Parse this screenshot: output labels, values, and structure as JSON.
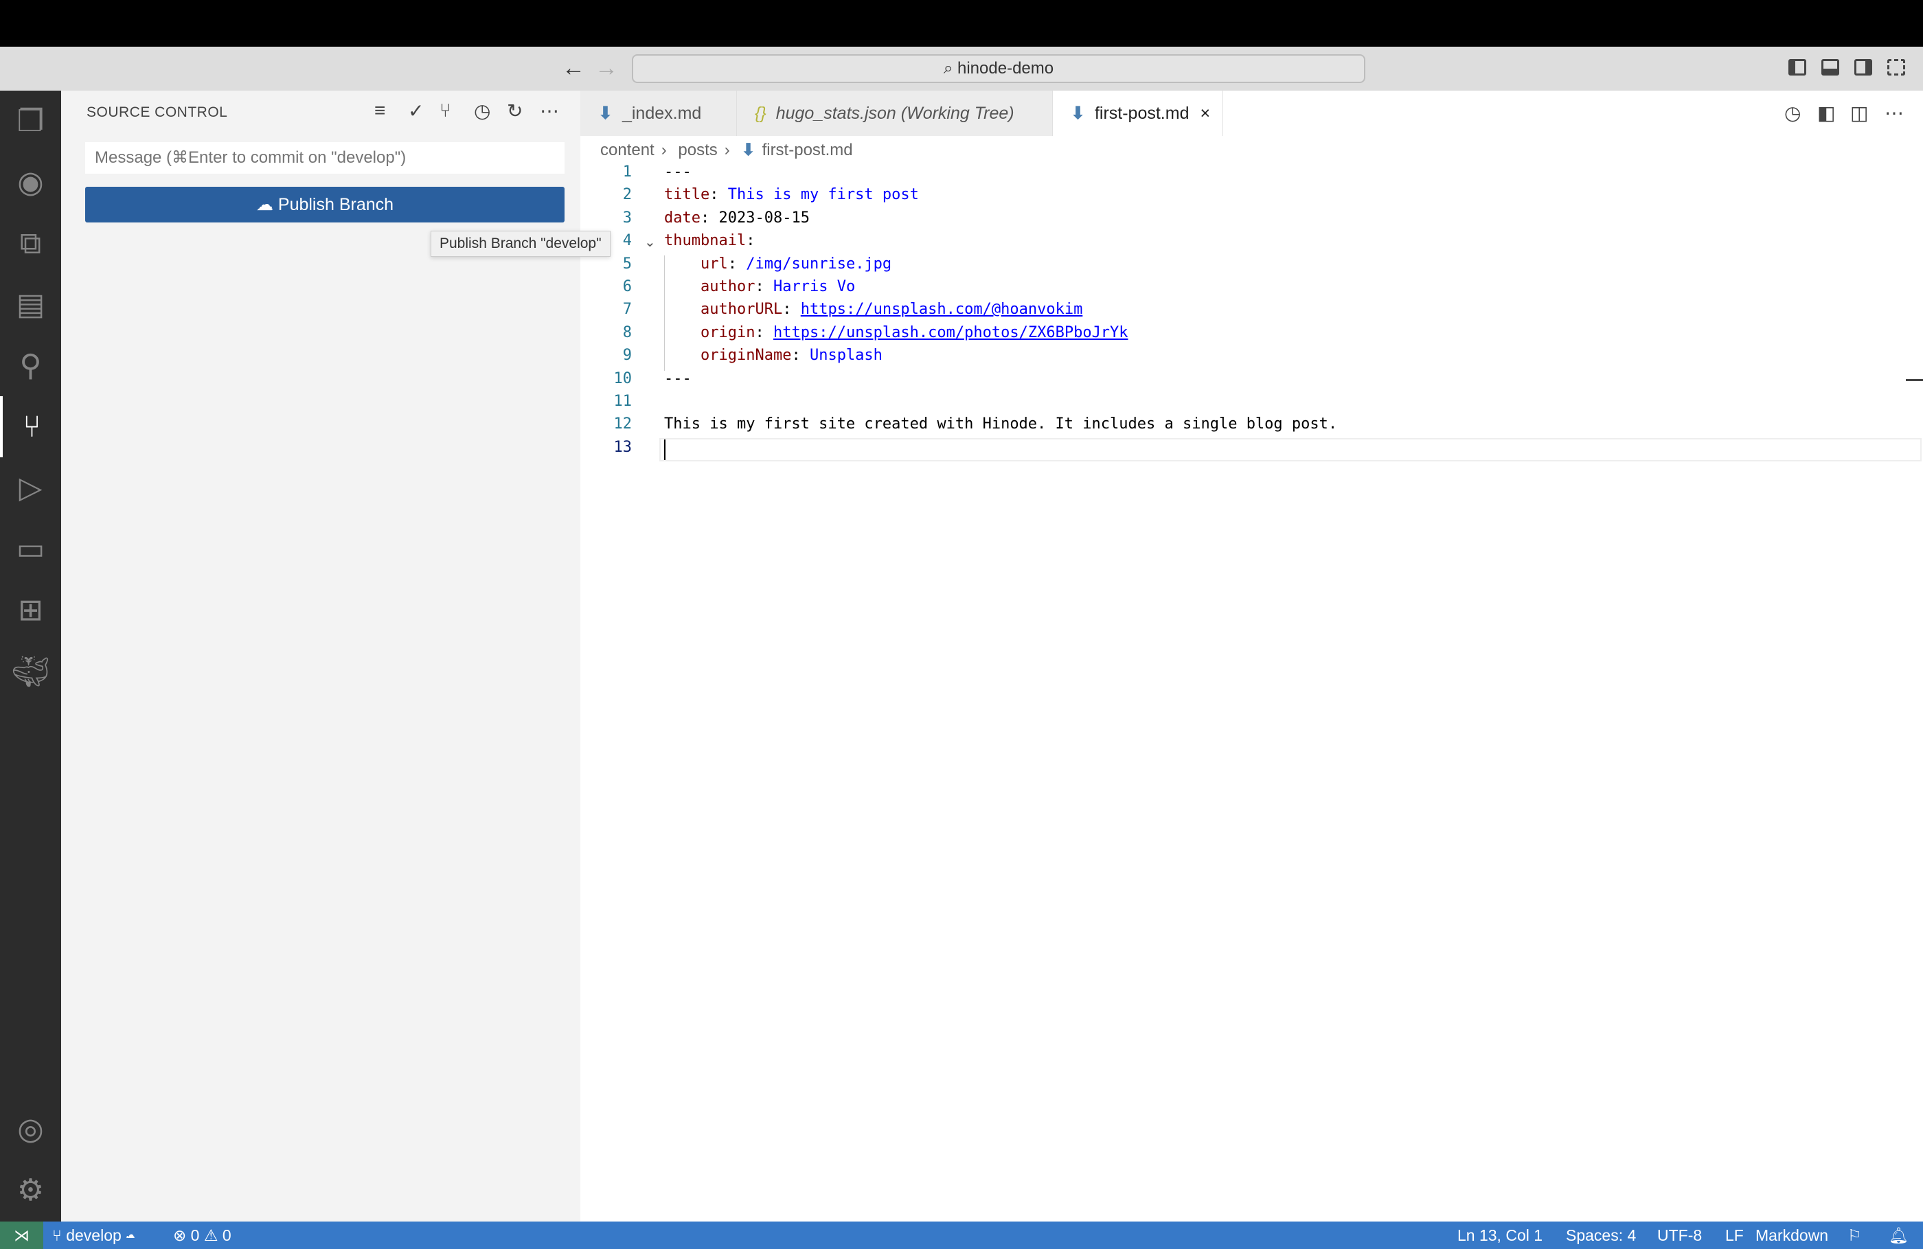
{
  "title_bar": {
    "search": "hinode-demo",
    "back_icon": "arrow-left",
    "forward_icon": "arrow-right"
  },
  "activity_bar": [
    "explorer-icon",
    "github-icon",
    "remote-explorer-icon",
    "book-icon",
    "search-icon",
    "source-control-icon",
    "run-debug-icon",
    "remote-icon",
    "extensions-icon",
    "docker-icon",
    "account-icon",
    "settings-gear-icon"
  ],
  "sidebar": {
    "title": "SOURCE CONTROL",
    "message_placeholder": "Message (⌘Enter to commit on \"develop\")",
    "publish_label": "Publish Branch",
    "tooltip": "Publish Branch \"develop\""
  },
  "tabs": [
    {
      "label": "_index.md"
    },
    {
      "label": "hugo_stats.json (Working Tree)"
    },
    {
      "label": "first-post.md",
      "close": "×"
    }
  ],
  "breadcrumb": [
    "content",
    "posts",
    "first-post.md"
  ],
  "editor": {
    "line_numbers": [
      "1",
      "2",
      "3",
      "4",
      "5",
      "6",
      "7",
      "8",
      "9",
      "10",
      "11",
      "12",
      "13"
    ],
    "lines": [
      {
        "t": "---"
      },
      {
        "k": "title",
        "v": "This is my first post"
      },
      {
        "k": "date",
        "p": "2023-08-15"
      },
      {
        "k": "thumbnail"
      },
      {
        "k": "url",
        "v": "/img/sunrise.jpg",
        "indent": true
      },
      {
        "k": "author",
        "v": "Harris Vo",
        "indent": true
      },
      {
        "k": "authorURL",
        "u": "https://unsplash.com/@hoanvokim",
        "indent": true
      },
      {
        "k": "origin",
        "u": "https://unsplash.com/photos/ZX6BPboJrYk",
        "indent": true
      },
      {
        "k": "originName",
        "v": "Unsplash",
        "indent": true
      },
      {
        "t": "---"
      },
      {
        "t": ""
      },
      {
        "t": "This is my first site created with Hinode. It includes a single blog post."
      },
      {
        "t": ""
      }
    ]
  },
  "status_bar": {
    "branch": "develop",
    "errors": "0",
    "warnings": "0",
    "position": "Ln 13, Col 1",
    "spaces": "Spaces: 4",
    "encoding": "UTF-8",
    "eol": "LF",
    "language": "Markdown"
  },
  "colors": {
    "status_bar": "#3779c8",
    "publish_button": "#2a5f9e",
    "remote": "#3b7f5f"
  }
}
